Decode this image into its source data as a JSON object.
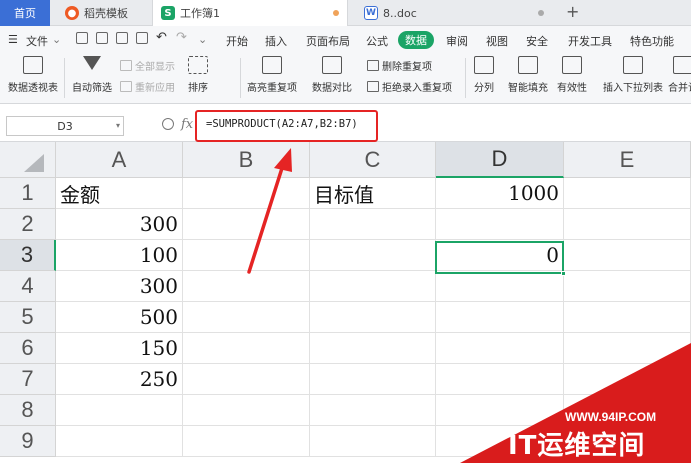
{
  "tabs": [
    {
      "label": "首页"
    },
    {
      "label": "稻壳模板"
    },
    {
      "label": "工作簿1"
    },
    {
      "label": "8..doc"
    }
  ],
  "menu": {
    "file": "文件",
    "items": [
      "开始",
      "插入",
      "页面布局",
      "公式",
      "数据",
      "审阅",
      "视图",
      "安全",
      "开发工具",
      "特色功能"
    ],
    "active": "数据"
  },
  "ribbon": {
    "pivot": "数据透视表",
    "autofilter": "自动筛选",
    "show_all": "全部显示",
    "reapply": "重新应用",
    "sort": "排序",
    "highlight_dup": "高亮重复项",
    "compare": "数据对比",
    "delete_dup": "删除重复项",
    "reject_dup": "拒绝录入重复项",
    "split": "分列",
    "smart_fill": "智能填充",
    "validity": "有效性",
    "dropdown": "插入下拉列表",
    "merge": "合并计"
  },
  "formula_bar": {
    "name_box": "D3",
    "fx": "fx",
    "formula": "=SUMPRODUCT(A2:A7,B2:B7)"
  },
  "sheet": {
    "columns": [
      "A",
      "B",
      "C",
      "D",
      "E"
    ],
    "rows": [
      "1",
      "2",
      "3",
      "4",
      "5",
      "6",
      "7",
      "8",
      "9"
    ],
    "selected_cell": "D3",
    "cells": {
      "A1": "金额",
      "A2": "300",
      "A3": "100",
      "A4": "300",
      "A5": "500",
      "A6": "150",
      "A7": "250",
      "C1": "目标值",
      "D1": "1000",
      "D3": "0"
    }
  },
  "watermark": {
    "url": "WWW.94IP.COM",
    "brand": "IT运维空间"
  },
  "colors": {
    "accent": "#1ba466",
    "annotation": "#e52424",
    "watermark": "#d91c1c"
  }
}
